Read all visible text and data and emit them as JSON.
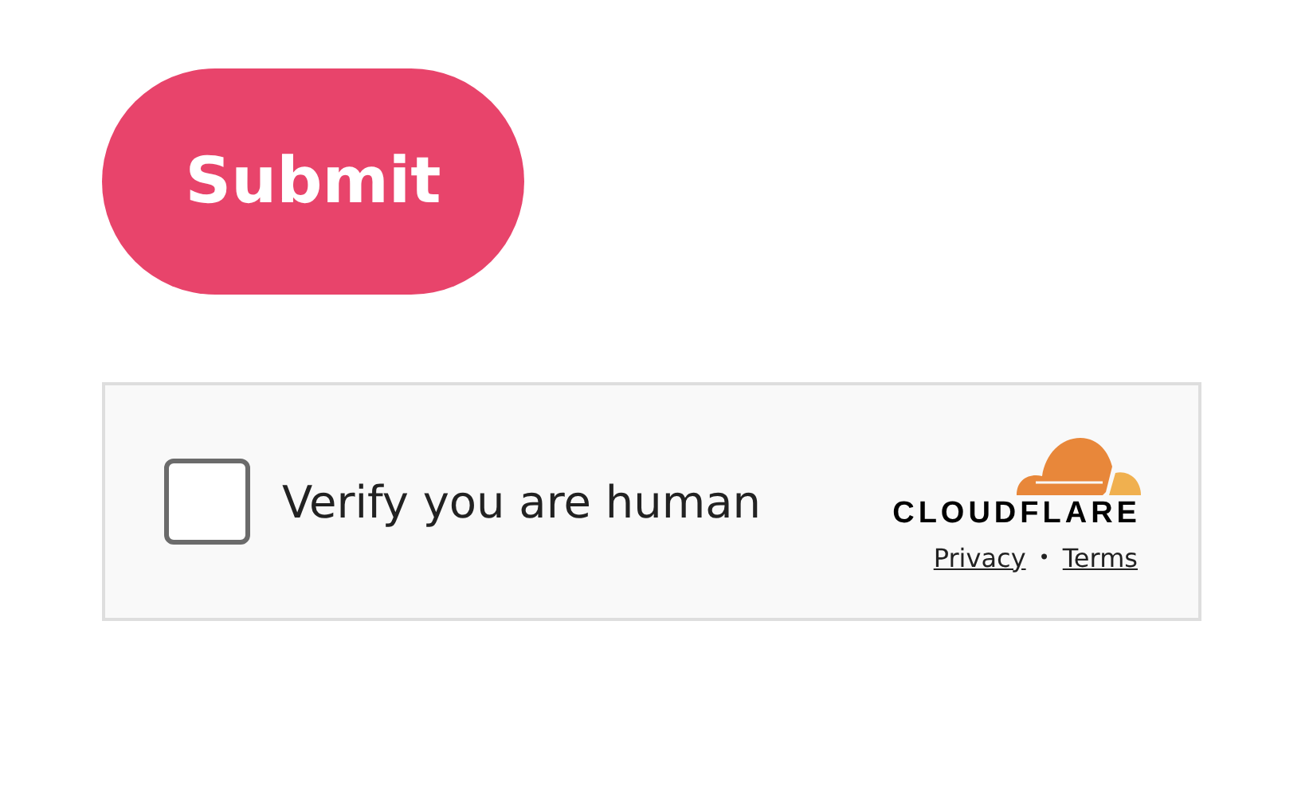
{
  "submit_button": {
    "label": "Submit"
  },
  "verification": {
    "checkbox": {
      "label": "Verify you are human",
      "checked": false
    },
    "logo": {
      "wordmark": "CLOUDFLARE"
    },
    "links": [
      {
        "label": "Privacy"
      },
      {
        "label": "Terms"
      }
    ],
    "separator": "•"
  }
}
